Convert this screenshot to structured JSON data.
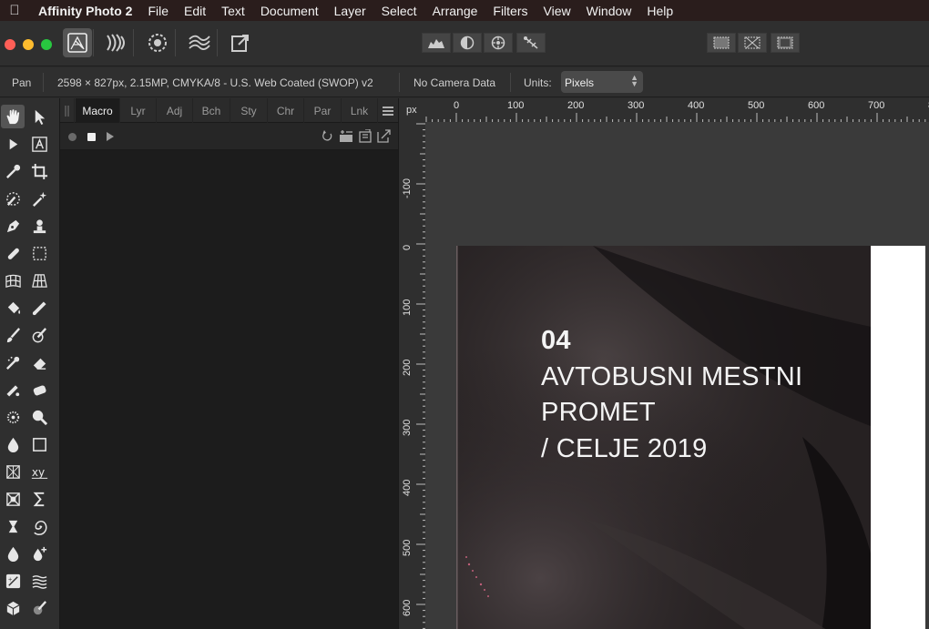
{
  "menubar": {
    "apple_icon": "apple-icon",
    "app_name": "Affinity Photo 2",
    "items": [
      "File",
      "Edit",
      "Text",
      "Document",
      "Layer",
      "Select",
      "Arrange",
      "Filters",
      "View",
      "Window",
      "Help"
    ]
  },
  "toolbar": {
    "personas": [
      "photo-persona-icon",
      "liquify-persona-icon",
      "develop-persona-icon",
      "tone-mapping-persona-icon",
      "export-persona-icon"
    ],
    "center_buttons": [
      "histogram-icon",
      "auto-contrast-icon",
      "auto-colors-icon",
      "auto-white-balance-icon"
    ],
    "right_buttons": [
      "selection-marquee-icon",
      "deselect-icon",
      "invert-selection-icon"
    ]
  },
  "context": {
    "tool": "Pan",
    "doc_info": "2598 × 827px, 2.15MP, CMYKA/8 - U.S. Web Coated (SWOP) v2",
    "camera": "No Camera Data",
    "units_label": "Units:",
    "units_value": "Pixels"
  },
  "panel": {
    "tabs": [
      "Macro",
      "Lyr",
      "Adj",
      "Bch",
      "Sty",
      "Chr",
      "Par",
      "Lnk"
    ],
    "active_tab": "Macro"
  },
  "rulers": {
    "unit": "px",
    "h_labels": [
      "0",
      "100",
      "200",
      "300",
      "400",
      "500",
      "600",
      "700",
      "8"
    ],
    "v_labels": [
      "-100",
      "0",
      "100",
      "200",
      "300",
      "400",
      "500",
      "600"
    ]
  },
  "document": {
    "number": "04",
    "line1": "AVTOBUSNI MESTNI",
    "line2": "PROMET",
    "line3": "/ CELJE 2019"
  },
  "colors": {
    "menubar_bg": "#2a1d1c",
    "ui_bg": "#2f2f2f",
    "canvas_bg": "#3a3a3a",
    "doc_bg": "#1f1b1c",
    "close": "#ff5f57",
    "minimize": "#febc2e",
    "zoom": "#28c840"
  }
}
